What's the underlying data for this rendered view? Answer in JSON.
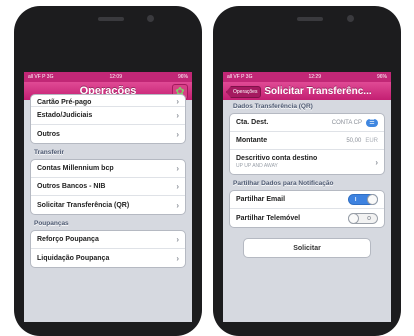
{
  "left_screen": {
    "statusbar": {
      "carrier": "all VF P 3G",
      "time": "12:09",
      "battery": "96%"
    },
    "title": "Operações",
    "settings_icon": "gear-icon",
    "partial_row": "Cartão Pré-pago",
    "rows_top": [
      {
        "label": "Estado/Judiciais"
      },
      {
        "label": "Outros"
      }
    ],
    "section_transfer": "Transferir",
    "rows_transfer": [
      {
        "label": "Contas Millennium bcp"
      },
      {
        "label": "Outros Bancos - NIB"
      },
      {
        "label": "Solicitar Transferência (QR)"
      }
    ],
    "section_savings": "Poupanças",
    "rows_savings": [
      {
        "label": "Reforço Poupança"
      },
      {
        "label": "Liquidação Poupança"
      }
    ]
  },
  "right_screen": {
    "statusbar": {
      "carrier": "all VF P 3G",
      "time": "12:29",
      "battery": "96%"
    },
    "back_label": "Operações",
    "title": "Solicitar Transferênc...",
    "section_data": "Dados Transferência (QR)",
    "account_label": "Cta. Dest.",
    "account_value": "CONTA CP",
    "contact_icon": "contact-icon",
    "amount_label": "Montante",
    "amount_value": "50,00",
    "amount_unit": "EUR",
    "description_label": "Descritivo conta destino",
    "description_sub": "UP UP AND AWAY",
    "section_share": "Partilhar Dados para Notificação",
    "email_label": "Partilhar Email",
    "email_toggle": "I",
    "phone_label": "Partilhar Telemóvel",
    "phone_toggle": "O",
    "submit_label": "Solicitar"
  },
  "colors": {
    "accent": "#c31f72",
    "toggle_on": "#3d82e0",
    "background": "#d6d9e0"
  }
}
